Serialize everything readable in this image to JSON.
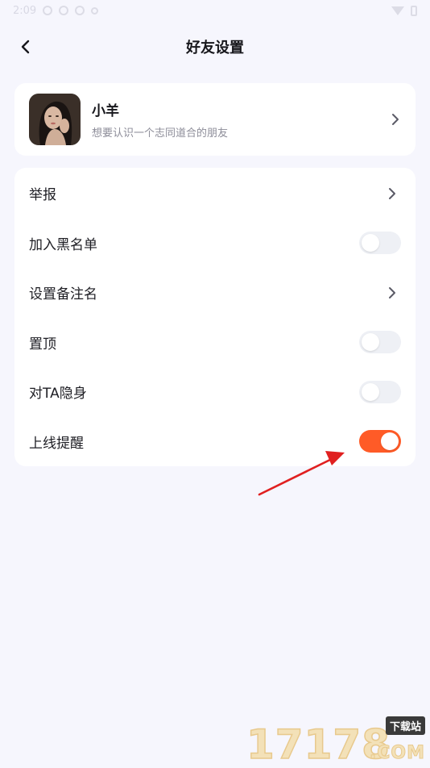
{
  "status_bar": {
    "time": "2:09"
  },
  "header": {
    "title": "好友设置"
  },
  "profile": {
    "name": "小羊",
    "bio": "想要认识一个志同道合的朋友"
  },
  "settings": {
    "report_label": "举报",
    "blacklist_label": "加入黑名单",
    "blacklist_on": false,
    "remark_label": "设置备注名",
    "pin_label": "置顶",
    "pin_on": false,
    "invisible_label": "对TA隐身",
    "invisible_on": false,
    "online_alert_label": "上线提醒",
    "online_alert_on": true
  },
  "colors": {
    "accent": "#ff5b27",
    "background": "#f6f6fd",
    "card": "#ffffff",
    "annotation_arrow": "#e02020"
  },
  "watermark": {
    "digits": "17178",
    "tag": "下载站",
    "suffix": ".COM"
  }
}
